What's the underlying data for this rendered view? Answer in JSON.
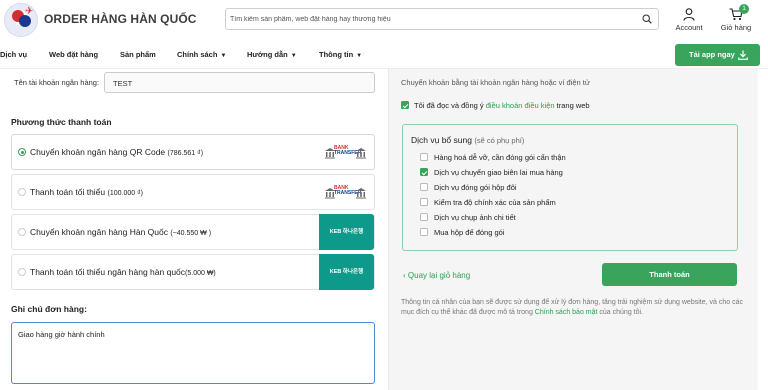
{
  "header": {
    "brand": "ORDER HÀNG HÀN QUỐC",
    "search_placeholder": "Tìm kiếm sản phẩm, web đặt hàng hay thương hiệu",
    "account_label": "Account",
    "cart_label": "Giỏ hàng",
    "cart_count": "1"
  },
  "nav": {
    "items": [
      "Dịch vụ",
      "Web đặt hàng",
      "Sản phẩm",
      "Chính sách",
      "Hướng dẫn",
      "Thông tin"
    ],
    "app_button": "Tải app ngay"
  },
  "form": {
    "account_name_label": "Tên tài khoản ngân hàng:",
    "account_name_value": "TEST",
    "payment_title": "Phương thức thanh toán",
    "payment_methods": [
      {
        "name": "Chuyển khoản ngân hàng QR Code",
        "amount": "(786.561 ₫)",
        "selected": true,
        "logo": "bank-transfer"
      },
      {
        "name": "Thanh toán tối thiểu",
        "amount": "(100.000 ₫)",
        "selected": false,
        "logo": "bank-transfer"
      },
      {
        "name": "Chuyển khoản ngân hàng Hàn Quốc",
        "amount": "(~40.550 ₩ )",
        "selected": false,
        "logo": "keb-hana"
      },
      {
        "name": "Thanh toán tối thiểu ngân hàng hàn quốc",
        "amount": "(5.000 ₩)",
        "selected": false,
        "logo": "keb-hana"
      }
    ],
    "logo_bank": "BANK",
    "logo_transfer": "TRANSFER",
    "logo_keb": "KEB 하나은행",
    "note_title": "Ghi chú đơn hàng:",
    "note_value": "Giao hàng giờ hành chính"
  },
  "panel": {
    "intro": "Chuyển khoản bằng tài khoản ngân hàng hoặc ví điện tử",
    "terms_prefix": "Tôi đã đọc và đồng ý",
    "terms_link": "điều khoản điều kiện",
    "terms_suffix": "trang web",
    "services_title": "Dịch vụ bổ sung",
    "services_note": "(sẽ có phụ phí)",
    "services": [
      {
        "label": "Hàng hoá dễ vỡ, cần đóng gói cẩn thận",
        "checked": false
      },
      {
        "label": "Dịch vụ chuyển giao biên lai mua hàng",
        "checked": true
      },
      {
        "label": "Dịch vụ đóng gói hộp đôi",
        "checked": false
      },
      {
        "label": "Kiểm tra độ chính xác của sản phẩm",
        "checked": false
      },
      {
        "label": "Dịch vụ chụp ảnh chi tiết",
        "checked": false
      },
      {
        "label": "Mua hộp để đóng gói",
        "checked": false
      }
    ],
    "back_label": "Quay lại giỏ hàng",
    "pay_button": "Thanh toán",
    "privacy_prefix": "Thông tin cá nhân của bạn sẽ được sử dụng để xử lý đơn hàng, tăng trải nghiệm sử dụng website, và cho các mục đích cụ thể khác đã được mô tả trong",
    "privacy_link": "Chính sách bảo mật",
    "privacy_suffix": "của chúng tôi."
  },
  "colors": {
    "accent": "#3aa35c",
    "keb": "#0e9a8a",
    "focus": "#4d89d6"
  }
}
